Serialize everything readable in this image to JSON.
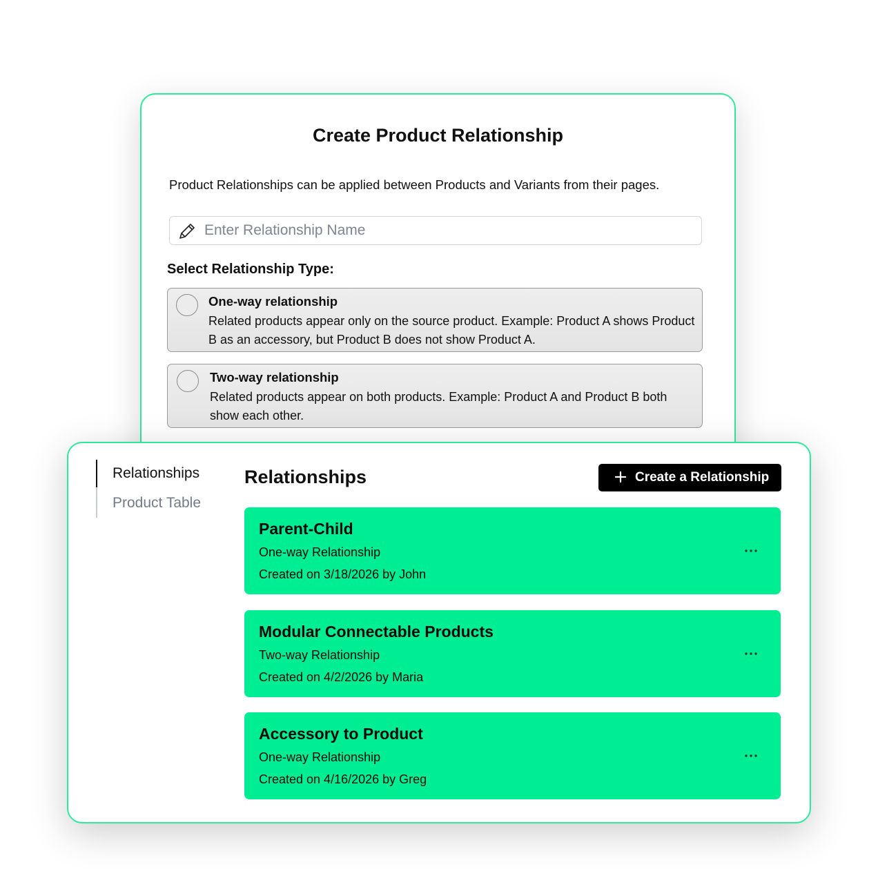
{
  "dialog": {
    "title": "Create Product Relationship",
    "description": "Product Relationships can be applied between Products and Variants from their pages.",
    "name_input": {
      "value": "",
      "placeholder": "Enter Relationship Name"
    },
    "type_label": "Select Relationship Type:",
    "options": [
      {
        "title": "One-way relationship",
        "description": "Related products appear only on the source product. Example: Product A shows Product B as an accessory, but Product B does not show Product A.",
        "selected": false
      },
      {
        "title": "Two-way relationship",
        "description": "Related products appear on both products. Example: Product A and Product B both show each other.",
        "selected": false
      }
    ]
  },
  "panel": {
    "sidebar": {
      "items": [
        {
          "label": "Relationships",
          "active": true
        },
        {
          "label": "Product Table",
          "active": false
        }
      ]
    },
    "title": "Relationships",
    "create_button_label": "Create a Relationship",
    "relationships": [
      {
        "name": "Parent-Child",
        "type": "One-way Relationship",
        "created": "Created on 3/18/2026 by John"
      },
      {
        "name": "Modular Connectable Products",
        "type": "Two-way Relationship",
        "created": "Created on 4/2/2026 by Maria"
      },
      {
        "name": "Accessory to Product",
        "type": "One-way Relationship",
        "created": "Created on 4/16/2026 by Greg"
      }
    ]
  },
  "colors": {
    "accent_border": "#2ee89c",
    "card_background": "#00ee93",
    "button_background": "#000000",
    "inactive_nav_text": "#737b87"
  },
  "icons": {
    "name_input": "pencil-icon",
    "create_button": "plus-icon",
    "card_menu": "more-horizontal-icon"
  }
}
